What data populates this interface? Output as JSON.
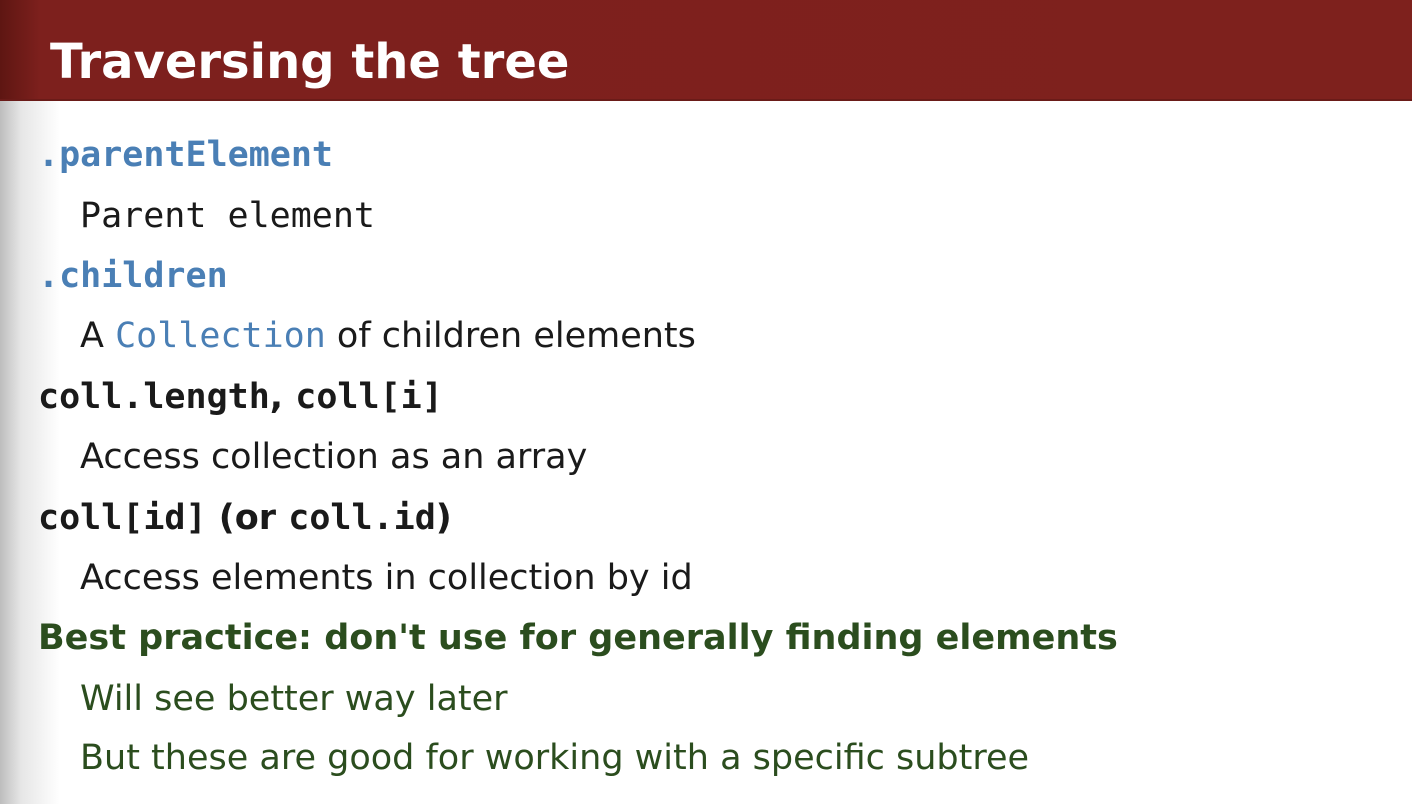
{
  "slide": {
    "title": "Traversing the tree"
  },
  "items": [
    {
      "term": ".parentElement",
      "desc": "Parent element"
    },
    {
      "term": ".children",
      "desc_prefix": "A ",
      "desc_code": "Collection",
      "desc_suffix": " of children elements"
    },
    {
      "term_code_1": "coll.length",
      "term_sep": ", ",
      "term_code_2": "coll[i]",
      "desc": "Access collection as an array"
    },
    {
      "term_code_1": "coll[id]",
      "term_mid": " (or ",
      "term_code_2": "coll.id",
      "term_end": ")",
      "desc": "Access elements in collection by id"
    }
  ],
  "best_practice": {
    "heading": "Best practice: don't use for generally finding elements",
    "points": [
      "Will see better way later",
      "But these are good for working with a specific subtree"
    ]
  },
  "colors": {
    "title_bar": "#7e211d",
    "code_blue": "#4a7fb5",
    "best_practice_green": "#2b4d1e"
  }
}
